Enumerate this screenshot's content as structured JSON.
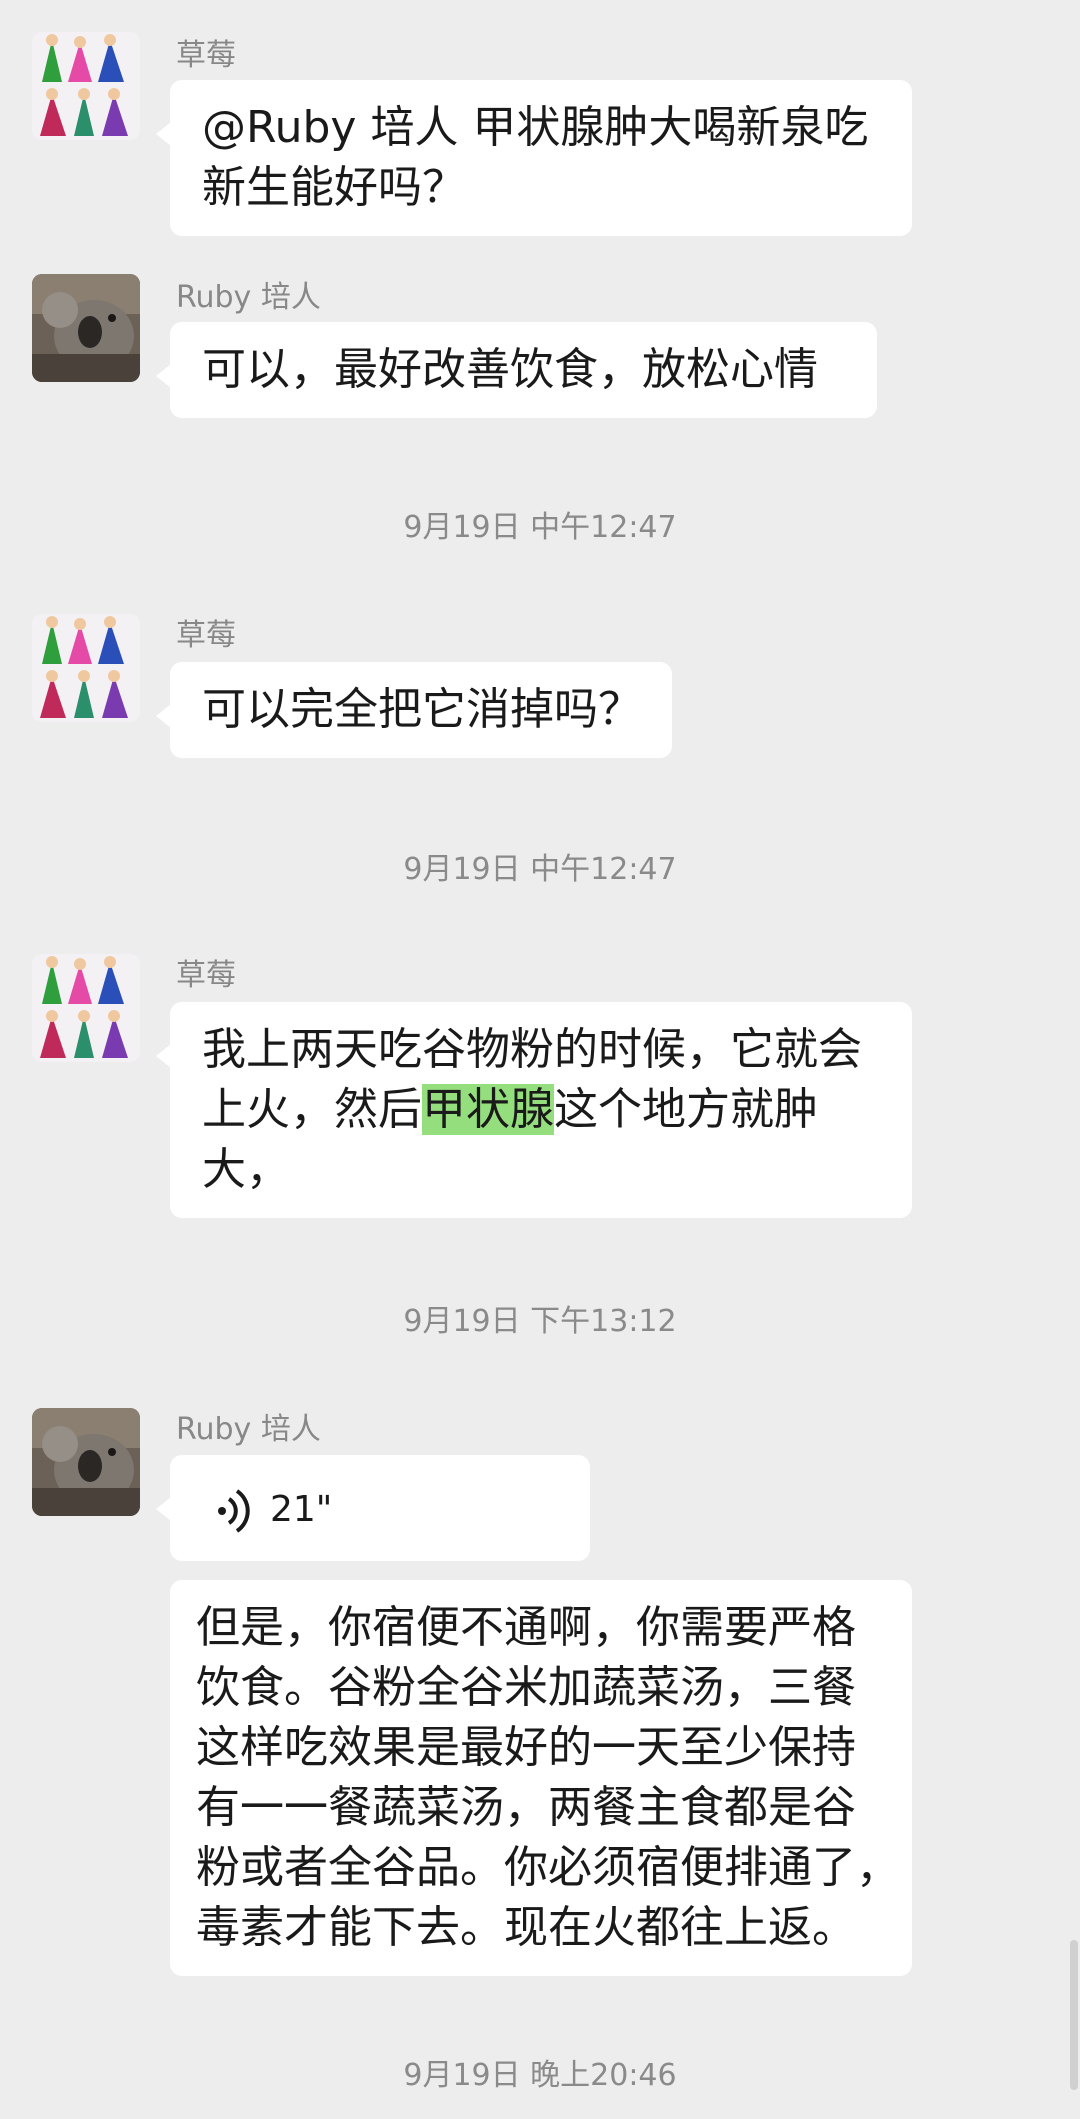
{
  "messages": [
    {
      "sender": "草莓",
      "lines": [
        "@Ruby 培人  甲状腺肿大喝新泉吃",
        "新生能好吗？"
      ]
    },
    {
      "sender": "Ruby 培人",
      "lines": [
        "可以，最好改善饮食，放松心情"
      ]
    },
    {
      "sender": "草莓",
      "lines": [
        "可以完全把它消掉吗？"
      ]
    },
    {
      "sender": "草莓",
      "line1": "我上两天吃谷物粉的时候，它就会",
      "line2_before": "上火，然后",
      "line2_highlight": "甲状腺",
      "line2_after": "这个地方就肿",
      "line3": "大，"
    },
    {
      "sender": "Ruby 培人",
      "voice_duration": "21\""
    },
    {
      "lines": [
        "但是，你宿便不通啊，你需要严格",
        "饮食。谷粉全谷米加蔬菜汤，三餐",
        "这样吃效果是最好的一天至少保持",
        "有一一餐蔬菜汤，两餐主食都是谷",
        "粉或者全谷品。你必须宿便排通了，",
        "毒素才能下去。现在火都往上返。"
      ]
    }
  ],
  "timestamps": [
    "9月19日 中午12:47",
    "9月19日 中午12:47",
    "9月19日 下午13:12",
    "9月19日 晚上20:46"
  ],
  "colors": {
    "background": "#ededed",
    "bubble": "#ffffff",
    "highlight": "#95de7e",
    "meta_text": "#888888"
  },
  "icons": {
    "voice": "voice-wave-icon",
    "avatar_strawberry": "princess-cartoon-avatar",
    "avatar_ruby": "koala-photo-avatar"
  }
}
